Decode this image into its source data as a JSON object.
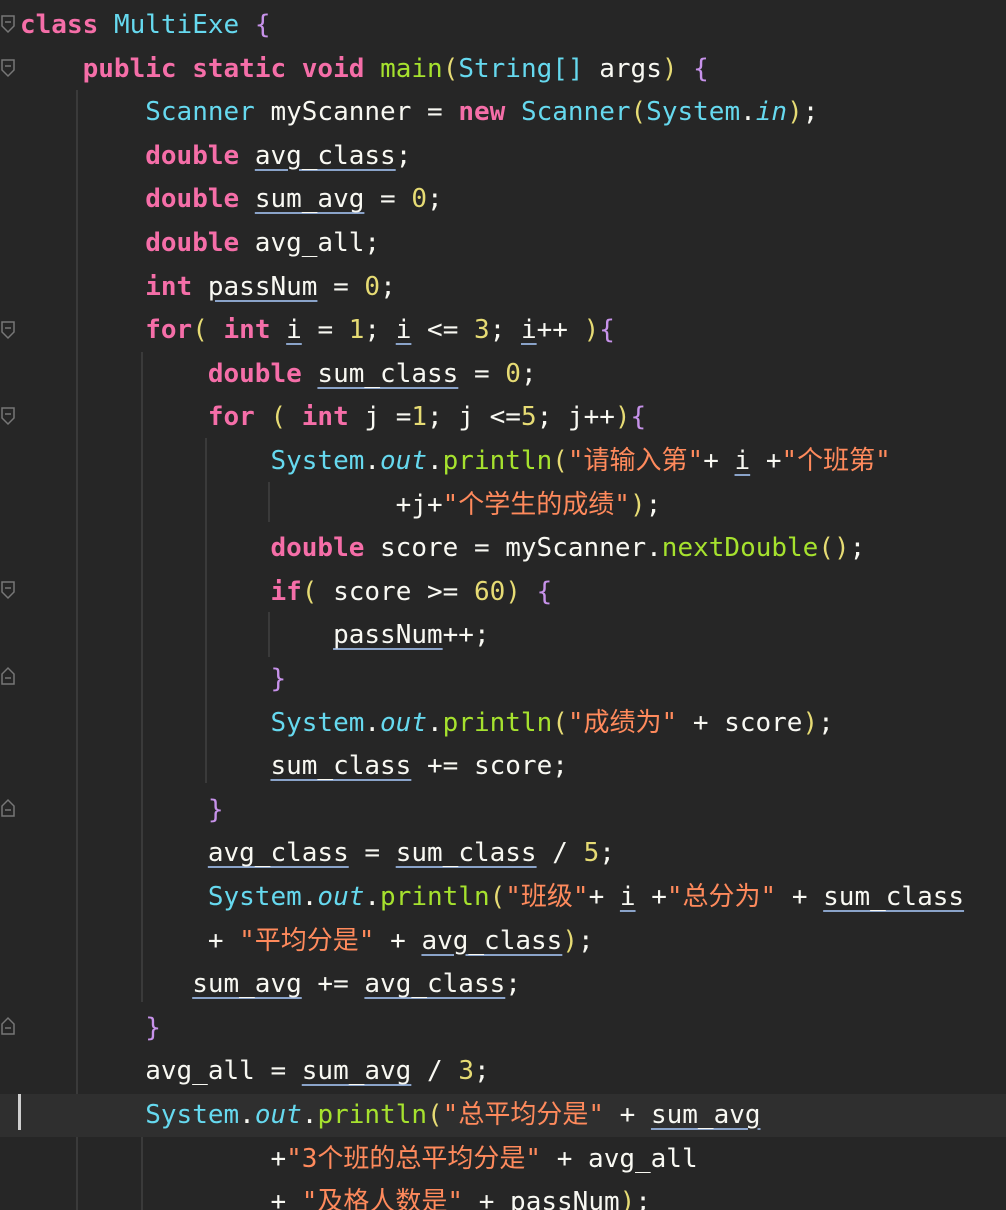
{
  "editor": {
    "code_lines": [
      "class MultiExe {",
      "    public static void main(String[] args) {",
      "        Scanner myScanner = new Scanner(System.in);",
      "        double avg_class;",
      "        double sum_avg = 0;",
      "        double avg_all;",
      "        int passNum = 0;",
      "        for( int i = 1; i <= 3; i++ ){",
      "            double sum_class = 0;",
      "            for ( int j =1; j <=5; j++){",
      "                System.out.println(\"请输入第\"+ i +\"个班第\"",
      "                        +j+\"个学生的成绩\");",
      "                double score = myScanner.nextDouble();",
      "                if( score >= 60) {",
      "                    passNum++;",
      "                }",
      "                System.out.println(\"成绩为\" + score);",
      "                sum_class += score;",
      "            }",
      "            avg_class = sum_class / 5;",
      "            System.out.println(\"班级\"+ i +\"总分为\" + sum_class",
      "            + \"平均分是\" + avg_class);",
      "           sum_avg += avg_class;",
      "        }",
      "        avg_all = sum_avg / 3;",
      "        System.out.println(\"总平均分是\" + sum_avg",
      "                +\"3个班的总平均分是\" + avg_all",
      "                + \"及格人数是\" + passNum);"
    ],
    "current_line_index": 25,
    "colors": {
      "background": "#262626",
      "current_line": "#2f2f2f",
      "keyword": "#f56ea8",
      "type": "#66d9ef",
      "function": "#a6e22e",
      "number": "#e6db74",
      "string": "#ff8a5c",
      "text": "#f8f8f2"
    }
  }
}
